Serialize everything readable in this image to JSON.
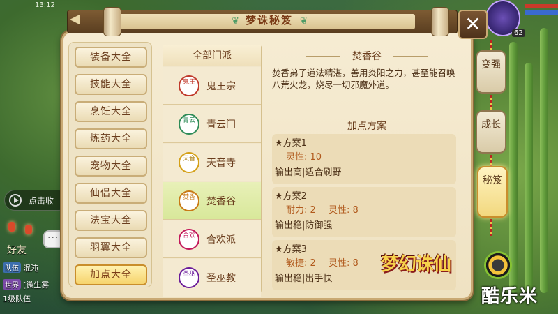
{
  "status": {
    "time": "13:12"
  },
  "hud": {
    "level": "62"
  },
  "panel": {
    "title": "梦诛秘笈",
    "close_glyph": "✕"
  },
  "categories": [
    {
      "label": "装备大全",
      "active": false
    },
    {
      "label": "技能大全",
      "active": false
    },
    {
      "label": "烹饪大全",
      "active": false
    },
    {
      "label": "炼药大全",
      "active": false
    },
    {
      "label": "宠物大全",
      "active": false
    },
    {
      "label": "仙侣大全",
      "active": false
    },
    {
      "label": "法宝大全",
      "active": false
    },
    {
      "label": "羽翼大全",
      "active": false
    },
    {
      "label": "加点大全",
      "active": true
    }
  ],
  "sects": {
    "header": "全部门派",
    "items": [
      {
        "name": "鬼王宗",
        "badge": "鬼王",
        "color": "#c0392b",
        "active": false
      },
      {
        "name": "青云门",
        "badge": "青云",
        "color": "#2e8b57",
        "active": false
      },
      {
        "name": "天音寺",
        "badge": "天音",
        "color": "#d4a017",
        "active": false
      },
      {
        "name": "焚香谷",
        "badge": "焚香",
        "color": "#c97a16",
        "active": true
      },
      {
        "name": "合欢派",
        "badge": "合欢",
        "color": "#c2185b",
        "active": false
      },
      {
        "name": "圣巫教",
        "badge": "圣巫",
        "color": "#6a1b9a",
        "active": false
      }
    ]
  },
  "detail": {
    "sect_title": "焚香谷",
    "description": "焚香弟子道法精湛，善用炎阳之力，甚至能召唤八荒火龙，烧尽一切邪魔外道。",
    "plans_title": "加点方案",
    "plans": [
      {
        "name": "★方案1",
        "stats": [
          "灵性: 10"
        ],
        "desc": "输出高|适合刷野"
      },
      {
        "name": "★方案2",
        "stats": [
          "耐力: 2",
          "灵性: 8"
        ],
        "desc": "输出稳|防御强"
      },
      {
        "name": "★方案3",
        "stats": [
          "敏捷: 2",
          "灵性: 8"
        ],
        "desc": "输出稳|出手快"
      }
    ]
  },
  "side_tabs": [
    {
      "label": "变强",
      "active": false
    },
    {
      "label": "成长",
      "active": false
    },
    {
      "label": "秘笈",
      "active": true
    }
  ],
  "chat": {
    "auto_play": "点击收",
    "friends": "好友",
    "lines": [
      {
        "tag": "队伍",
        "text": "混沌"
      },
      {
        "tag": "世界",
        "text": "[微生雾"
      },
      {
        "tag": "",
        "text": "1级队伍"
      }
    ]
  },
  "branding": {
    "game_logo": "梦幻诛仙",
    "watermark": "酷乐米"
  }
}
